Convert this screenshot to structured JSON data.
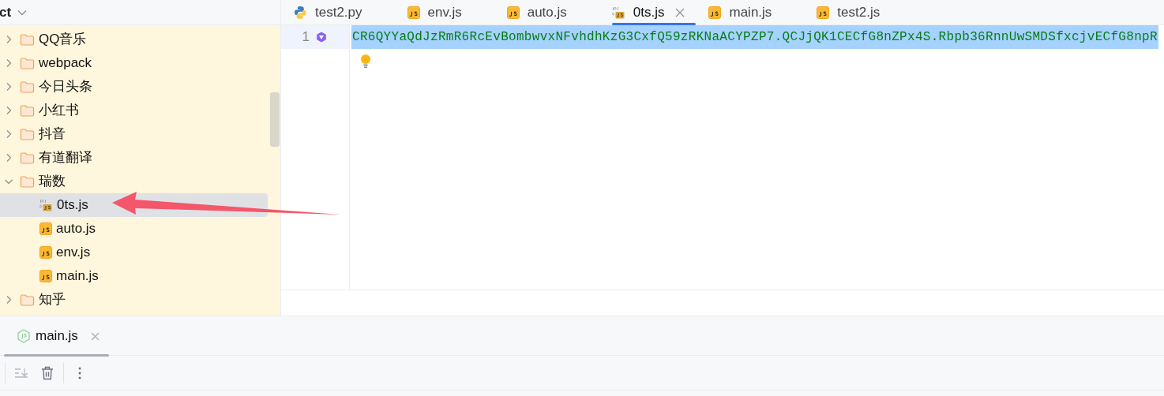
{
  "sidebar": {
    "title": "ct",
    "tree": [
      {
        "label": "QQ音乐",
        "kind": "folder",
        "expanded": false,
        "selected": false
      },
      {
        "label": "webpack",
        "kind": "folder",
        "expanded": false,
        "selected": false
      },
      {
        "label": "今日头条",
        "kind": "folder",
        "expanded": false,
        "selected": false
      },
      {
        "label": "小红书",
        "kind": "folder",
        "expanded": false,
        "selected": false
      },
      {
        "label": "抖音",
        "kind": "folder",
        "expanded": false,
        "selected": false
      },
      {
        "label": "有道翻译",
        "kind": "folder",
        "expanded": false,
        "selected": false
      },
      {
        "label": "瑞数",
        "kind": "folder",
        "expanded": true,
        "selected": false,
        "children": [
          {
            "label": "0ts.js",
            "kind": "binary-js",
            "selected": true
          },
          {
            "label": "auto.js",
            "kind": "js",
            "selected": false
          },
          {
            "label": "env.js",
            "kind": "js",
            "selected": false
          },
          {
            "label": "main.js",
            "kind": "js",
            "selected": false
          }
        ]
      },
      {
        "label": "知乎",
        "kind": "folder",
        "expanded": false,
        "selected": false
      }
    ]
  },
  "editor_tabs": [
    {
      "label": "test2.py",
      "kind": "python",
      "selected": false
    },
    {
      "label": "env.js",
      "kind": "js",
      "selected": false
    },
    {
      "label": "auto.js",
      "kind": "js",
      "selected": false
    },
    {
      "label": "0ts.js",
      "kind": "binary-js",
      "selected": true
    },
    {
      "label": "main.js",
      "kind": "js",
      "selected": false
    },
    {
      "label": "test2.js",
      "kind": "js",
      "selected": false
    }
  ],
  "editor": {
    "lines": [
      {
        "number": "1",
        "text": "CR6QYYaQdJzRmR6RcEvBombwvxNFvhdhKzG3CxfQ59zRKNaACYPZP7.QCJjQK1CECfG8nZPx4S.Rbpb36RnnUwSMDSfxcjvECfG8npR",
        "selected": true
      }
    ]
  },
  "bottom_panel": {
    "tabs": [
      {
        "label": "main.js",
        "selected": true
      }
    ]
  }
}
